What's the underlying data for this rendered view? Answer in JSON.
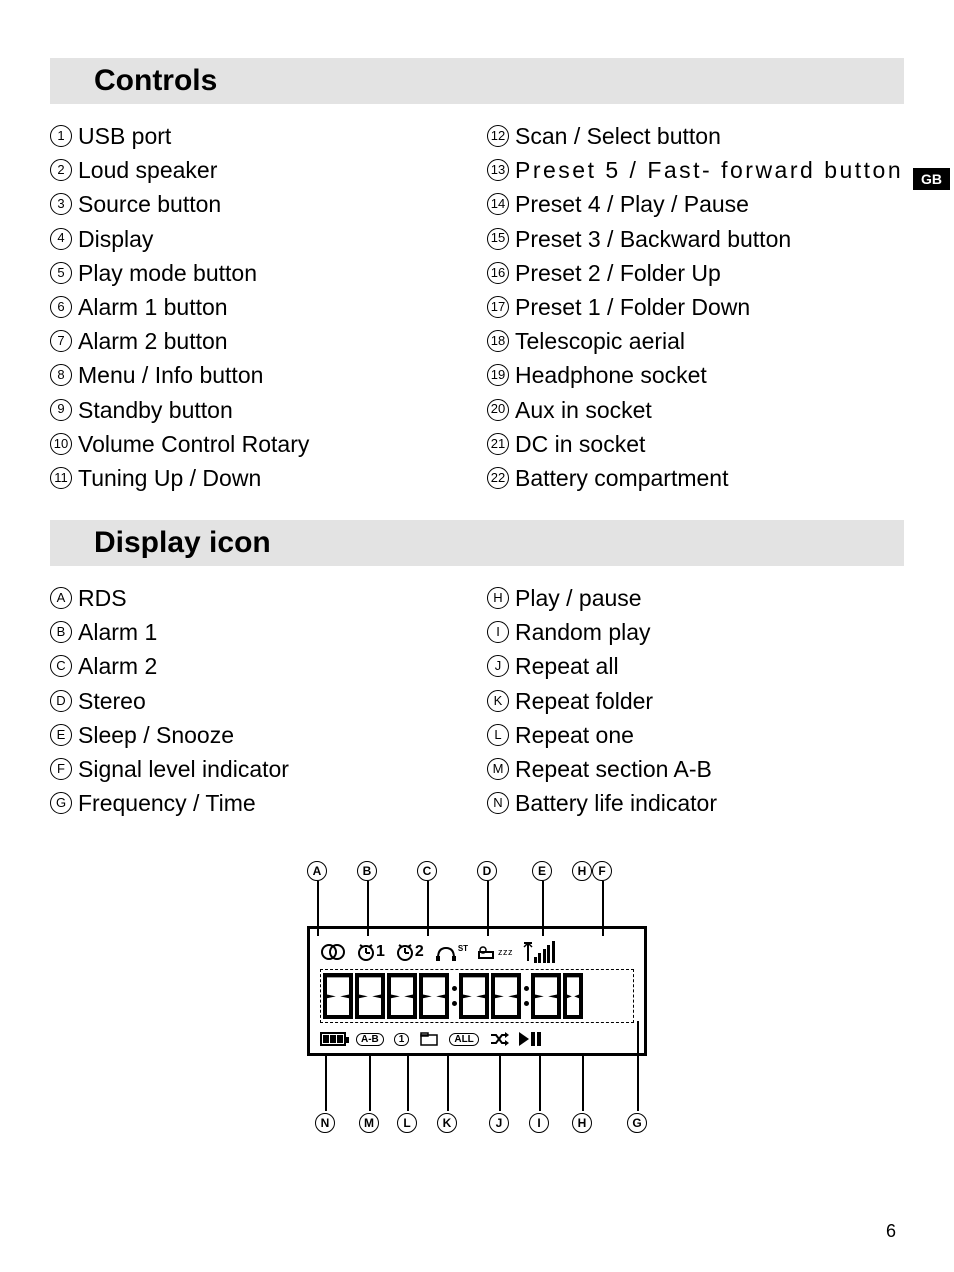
{
  "language_tab": "GB",
  "page_number": "6",
  "sections": {
    "controls": {
      "title": "Controls",
      "items_left": [
        {
          "num": "1",
          "text": "USB port"
        },
        {
          "num": "2",
          "text": "Loud speaker"
        },
        {
          "num": "3",
          "text": "Source button"
        },
        {
          "num": "4",
          "text": "Display"
        },
        {
          "num": "5",
          "text": "Play mode button"
        },
        {
          "num": "6",
          "text": "Alarm 1 button"
        },
        {
          "num": "7",
          "text": "Alarm 2 button"
        },
        {
          "num": "8",
          "text": "Menu / Info button"
        },
        {
          "num": "9",
          "text": "Standby button"
        },
        {
          "num": "10",
          "text": "Volume Control Rotary"
        },
        {
          "num": "11",
          "text": "Tuning Up / Down"
        }
      ],
      "items_right": [
        {
          "num": "12",
          "text": "Scan / Select button"
        },
        {
          "num": "13",
          "text": "Preset 5 / Fast- forward button",
          "wide": true
        },
        {
          "num": "14",
          "text": "Preset 4 / Play / Pause"
        },
        {
          "num": "15",
          "text": "Preset 3 / Backward button"
        },
        {
          "num": "16",
          "text": "Preset 2 / Folder Up"
        },
        {
          "num": "17",
          "text": "Preset 1 / Folder Down"
        },
        {
          "num": "18",
          "text": "Telescopic aerial"
        },
        {
          "num": "19",
          "text": "Headphone socket"
        },
        {
          "num": "20",
          "text": "Aux in socket"
        },
        {
          "num": "21",
          "text": "DC in socket"
        },
        {
          "num": "22",
          "text": "Battery compartment"
        }
      ]
    },
    "display_icon": {
      "title": "Display icon",
      "items_left": [
        {
          "num": "A",
          "text": "RDS"
        },
        {
          "num": "B",
          "text": "Alarm 1"
        },
        {
          "num": "C",
          "text": "Alarm 2"
        },
        {
          "num": "D",
          "text": "Stereo"
        },
        {
          "num": "E",
          "text": "Sleep / Snooze"
        },
        {
          "num": "F",
          "text": "Signal level indicator"
        },
        {
          "num": "G",
          "text": "Frequency / Time"
        }
      ],
      "items_right": [
        {
          "num": "H",
          "text": "Play / pause"
        },
        {
          "num": "I",
          "text": "Random play"
        },
        {
          "num": "J",
          "text": "Repeat all"
        },
        {
          "num": "K",
          "text": "Repeat folder"
        },
        {
          "num": "L",
          "text": "Repeat one"
        },
        {
          "num": "M",
          "text": "Repeat section A-B"
        },
        {
          "num": "N",
          "text": "Battery life indicator"
        }
      ]
    }
  },
  "diagram": {
    "top_labels": [
      "A",
      "B",
      "C",
      "D",
      "E",
      "F"
    ],
    "bottom_labels": [
      "N",
      "M",
      "L",
      "K",
      "J",
      "I",
      "H",
      "G"
    ],
    "row1_icons": {
      "alarm1_suffix": "1",
      "alarm2_suffix": "2",
      "stereo_badge": "ST",
      "sleep_z": "z z z"
    },
    "row3_icons": {
      "ab_label": "A-B",
      "one_label": "1",
      "all_label": "ALL"
    }
  }
}
